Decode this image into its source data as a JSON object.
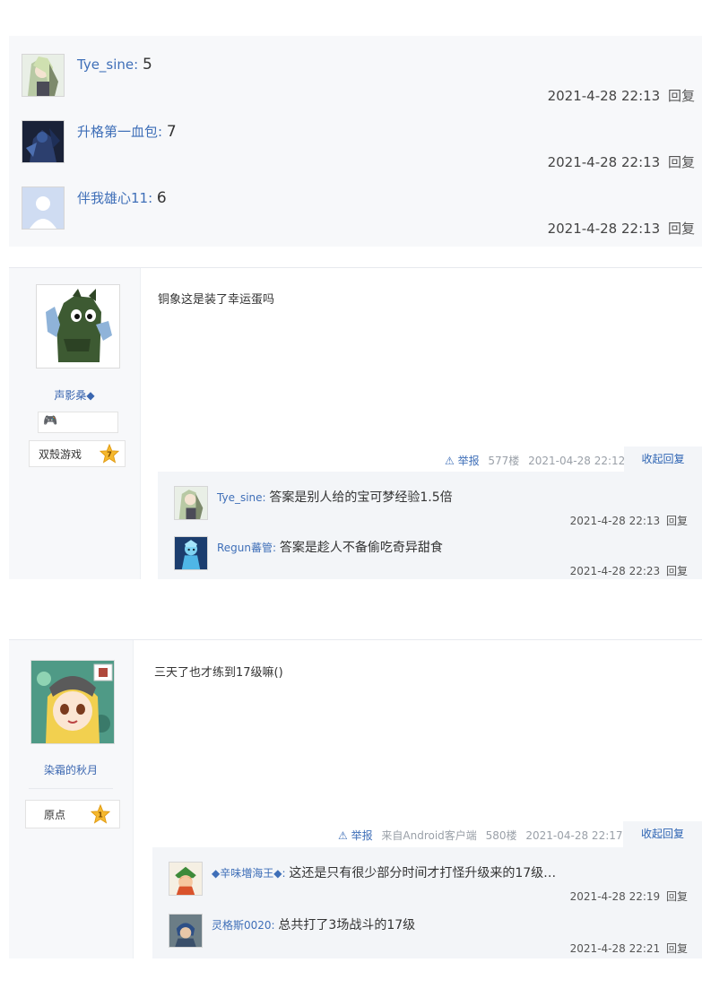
{
  "top_replies": [
    {
      "username": "Tye_sine",
      "separator": ": ",
      "text": "5",
      "time": "2021-4-28 22:13",
      "reply": "回复"
    },
    {
      "username": "升格第一血包",
      "separator": ": ",
      "text": "7",
      "time": "2021-4-28 22:13",
      "reply": "回复"
    },
    {
      "username": "伴我雄心11",
      "separator": ": ",
      "text": "6",
      "time": "2021-4-28 22:13",
      "reply": "回复"
    }
  ],
  "posts": [
    {
      "author": "声影桑◆",
      "badge": "双殼游戏",
      "level": "7",
      "content": "铜象这是装了幸运蛋吗",
      "report": "⚠ 举报",
      "source": "",
      "floor": "577楼",
      "time": "2021-04-28 22:12",
      "fold": "收起回复",
      "replies": [
        {
          "username": "Tye_sine",
          "separator": ": ",
          "text": "答案是别人给的宝可梦经验1.5倍",
          "time": "2021-4-28 22:13",
          "reply": "回复"
        },
        {
          "username": "Regun蕃管",
          "separator": ": ",
          "text": "答案是趁人不备偷吃奇异甜食",
          "time": "2021-4-28 22:23",
          "reply": "回复"
        }
      ]
    },
    {
      "author": "染霜的秋月",
      "badge": "原点",
      "level": "1",
      "content": "三天了也才练到17级嘛()",
      "report": "⚠ 举报",
      "source": "来自Android客户端",
      "floor": "580楼",
      "time": "2021-04-28 22:17",
      "fold": "收起回复",
      "replies": [
        {
          "username": "◆辛味増海王◆",
          "separator": ": ",
          "text": "这还是只有很少部分时间才打怪升级来的17级…",
          "time": "2021-4-28 22:19",
          "reply": "回复"
        },
        {
          "username": "灵格斯0020",
          "separator": ": ",
          "text": "总共打了3场战斗的17级",
          "time": "2021-4-28 22:21",
          "reply": "回复"
        }
      ]
    }
  ],
  "colors": {
    "link": "#3f6fb8",
    "panel": "#f7f8fa",
    "subpanel": "#f3f5f8",
    "level_star": "#f5b82e"
  }
}
